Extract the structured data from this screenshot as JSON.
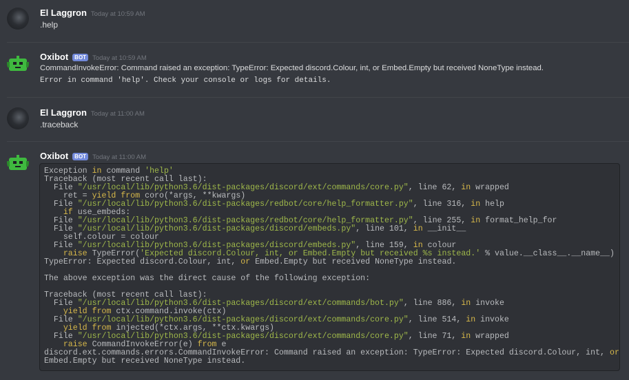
{
  "messages": [
    {
      "author": "El Laggron",
      "timestamp": "Today at 10:59 AM",
      "text": ".help"
    },
    {
      "author": "Oxibot",
      "badge": "BOT",
      "timestamp": "Today at 10:59 AM",
      "text": "CommandInvokeError: Command raised an exception: TypeError: Expected discord.Colour, int, or Embed.Empty but received NoneType instead.",
      "code_text": "Error in command 'help'. Check your console or logs for details."
    },
    {
      "author": "El Laggron",
      "timestamp": "Today at 11:00 AM",
      "text": ".traceback"
    },
    {
      "author": "Oxibot",
      "badge": "BOT",
      "timestamp": "Today at 11:00 AM"
    }
  ],
  "traceback_lines": [
    "Exception in command 'help'",
    "Traceback (most recent call last):",
    "  File \"/usr/local/lib/python3.6/dist-packages/discord/ext/commands/core.py\", line 62, in wrapped",
    "    ret = yield from coro(*args, **kwargs)",
    "  File \"/usr/local/lib/python3.6/dist-packages/redbot/core/help_formatter.py\", line 316, in help",
    "    if use_embeds:",
    "  File \"/usr/local/lib/python3.6/dist-packages/redbot/core/help_formatter.py\", line 255, in format_help_for",
    "  File \"/usr/local/lib/python3.6/dist-packages/discord/embeds.py\", line 101, in __init__",
    "    self.colour = colour",
    "  File \"/usr/local/lib/python3.6/dist-packages/discord/embeds.py\", line 159, in colour",
    "    raise TypeError('Expected discord.Colour, int, or Embed.Empty but received %s instead.' % value.__class__.__name__)",
    "TypeError: Expected discord.Colour, int, or Embed.Empty but received NoneType instead.",
    "",
    "The above exception was the direct cause of the following exception:",
    "",
    "Traceback (most recent call last):",
    "  File \"/usr/local/lib/python3.6/dist-packages/discord/ext/commands/bot.py\", line 886, in invoke",
    "    yield from ctx.command.invoke(ctx)",
    "  File \"/usr/local/lib/python3.6/dist-packages/discord/ext/commands/core.py\", line 514, in invoke",
    "    yield from injected(*ctx.args, **ctx.kwargs)",
    "  File \"/usr/local/lib/python3.6/dist-packages/discord/ext/commands/core.py\", line 71, in wrapped",
    "    raise CommandInvokeError(e) from e",
    "discord.ext.commands.errors.CommandInvokeError: Command raised an exception: TypeError: Expected discord.Colour, int, or",
    "Embed.Empty but received NoneType instead."
  ],
  "colors": {
    "background": "#36393f",
    "codeblock": "#2f3136",
    "bot_badge": "#7289da",
    "bot_avatar": "#3fb93f",
    "string": "#9fb84a",
    "keyword": "#d8b94a"
  },
  "icons": {
    "user_avatar": "dark-avatar-icon",
    "bot_avatar": "green-robot-avatar-icon"
  }
}
